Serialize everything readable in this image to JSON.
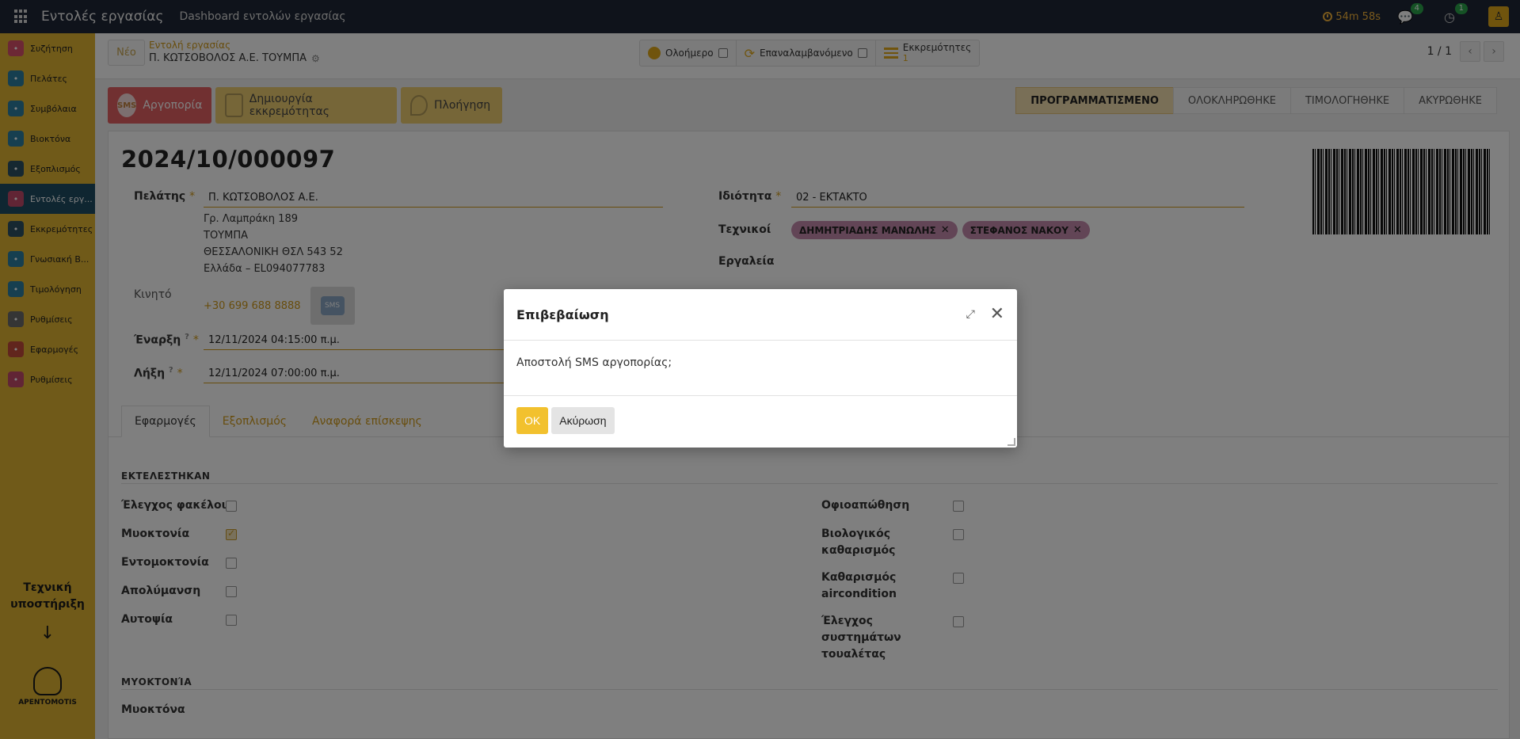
{
  "topbar": {
    "app_title": "Εντολές εργασίας",
    "menu_dashboard": "Dashboard εντολών εργασίας",
    "timer": "54m 58s",
    "messages_count": "4",
    "activities_count": "1"
  },
  "sidebar": {
    "items": [
      {
        "label": "Συζήτηση",
        "icon": "chat-icon",
        "color": "#d9506b"
      },
      {
        "label": "Πελάτες",
        "icon": "contacts-icon",
        "color": "#2d7fa0"
      },
      {
        "label": "Συμβόλαια",
        "icon": "contracts-icon",
        "color": "#2d7fa0"
      },
      {
        "label": "Βιοκτόνα",
        "icon": "biocide-icon",
        "color": "#2d7fa0"
      },
      {
        "label": "Εξοπλισμός",
        "icon": "tools-icon",
        "color": "#2d5063"
      },
      {
        "label": "Εντολές εργ...",
        "icon": "workorder-icon",
        "color": "#c24a6a"
      },
      {
        "label": "Εκκρεμότητες",
        "icon": "pen-icon",
        "color": "#2d5063"
      },
      {
        "label": "Γνωσιακή Β...",
        "icon": "knowledge-icon",
        "color": "#2d7fa0"
      },
      {
        "label": "Τιμολόγηση",
        "icon": "invoice-icon",
        "color": "#2d7fa0"
      },
      {
        "label": "Ρυθμίσεις",
        "icon": "gear-icon",
        "color": "#6a6a6a"
      },
      {
        "label": "Εφαρμογές",
        "icon": "apps-icon",
        "color": "#c24a3a"
      },
      {
        "label": "Ρυθμίσεις",
        "icon": "settings-icon",
        "color": "#c24a6a"
      }
    ],
    "support_line1": "Τεχνική",
    "support_line2": "υποστήριξη",
    "arrow": "↓",
    "logo_text": "ΑΡΕΝΤΟΜΟΤΙS"
  },
  "control_panel": {
    "new_button": "Νέο",
    "breadcrumb_parent": "Εντολή εργασίας",
    "breadcrumb_current": "Π. ΚΩΤΣΟΒΟΛΟΣ Α.Ε. ΤΟΥΜΠΑ",
    "stat_allday": "Ολοήμερο",
    "stat_recurring": "Επαναλαμβανόμενο",
    "stat_pending": "Εκκρεμότητες",
    "stat_pending_count": "1",
    "pager": "1 / 1"
  },
  "header": {
    "btn_delay": "Αργοπορία",
    "btn_delay_icon": "SMS",
    "btn_create_pending": "Δημιουργία εκκρεμότητας",
    "btn_navigation": "Πλοήγηση",
    "stages": [
      "ΠΡΟΓΡΑΜΜΑΤΙΣΜΕΝΟ",
      "ΟΛΟΚΛΗΡΩΘΗΚΕ",
      "ΤΙΜΟΛΟΓΗΘΗΚΕ",
      "ΑΚΥΡΩΘΗΚΕ"
    ]
  },
  "form": {
    "title": "2024/10/000097",
    "customer_label": "Πελάτης",
    "customer_value": "Π. ΚΩΤΣΟΒΟΛΟΣ Α.Ε.",
    "address": [
      "Γρ. Λαμπράκη 189",
      "ΤΟΥΜΠΑ",
      "ΘΕΣΣΑΛΟΝΙΚΗ ΘΣΛ 543 52",
      "Ελλάδα – EL094077783"
    ],
    "mobile_label": "Κινητό",
    "mobile_value": "+30 699 688 8888",
    "sms_icon": "SMS",
    "start_label": "Έναρξη",
    "start_value": "12/11/2024 04:15:00 π.μ.",
    "end_label": "Λήξη",
    "end_value": "12/11/2024 07:00:00 π.μ.",
    "priority_label": "Ιδιότητα",
    "priority_value": "02 - ΕΚΤΑΚΤΟ",
    "technicians_label": "Τεχνικοί",
    "technicians": [
      "ΔΗΜΗΤΡΙΑΔΗΣ ΜΑΝΩΛΗΣ",
      "ΣΤΕΦΑΝΟΣ ΝΑΚΟΥ"
    ],
    "tools_label": "Εργαλεία",
    "help_mark": "?",
    "required_mark": "*"
  },
  "tabs": [
    "Εφαρμογές",
    "Εξοπλισμός",
    "Αναφορά επίσκεψης"
  ],
  "executed": {
    "title": "ΕΚΤΕΛΕΣΤΗΚΑΝ",
    "left": [
      {
        "label": "Έλεγχος φακέλου",
        "checked": false
      },
      {
        "label": "Μυοκτονία",
        "checked": true
      },
      {
        "label": "Εντομοκτονία",
        "checked": false
      },
      {
        "label": "Απολύμανση",
        "checked": false
      },
      {
        "label": "Αυτοψία",
        "checked": false
      }
    ],
    "right": [
      {
        "label": "Οφιοαπώθηση",
        "checked": false
      },
      {
        "label": "Βιολογικός καθαρισμός",
        "checked": false
      },
      {
        "label": "Καθαρισμός aircondition",
        "checked": false
      },
      {
        "label": "Έλεγχος συστημάτων τουαλέτας",
        "checked": false
      }
    ]
  },
  "rodent_section": {
    "title": "ΜΥΟΚΤΟΝΊΑ",
    "field_label": "Μυοκτόνα"
  },
  "modal": {
    "title": "Επιβεβαίωση",
    "body": "Αποστολή SMS αργοπορίας;",
    "ok": "OK",
    "cancel": "Ακύρωση"
  }
}
